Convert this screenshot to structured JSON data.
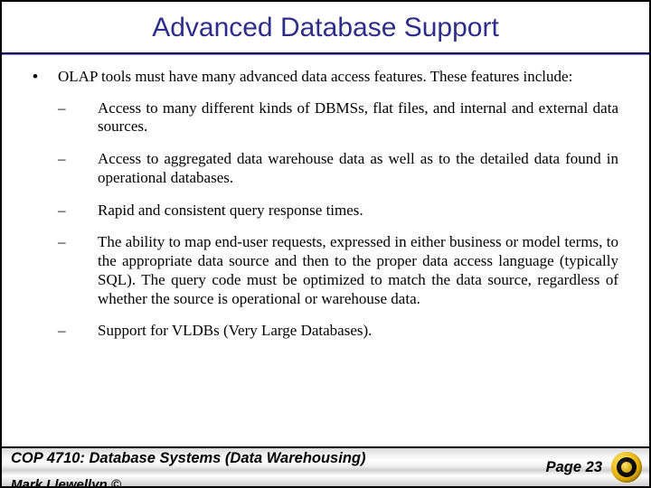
{
  "title": "Advanced Database Support",
  "intro": "OLAP tools must have many advanced data access features.  These features include:",
  "items": [
    "Access to many different kinds of DBMSs, flat files, and internal and external data sources.",
    "Access to aggregated data warehouse data as well as to the detailed data found in operational databases.",
    "Rapid and consistent query response times.",
    "The ability to map end-user requests, expressed in either business or model terms, to the appropriate data source and then to the proper data access language (typically SQL).  The query code must be optimized to match the data source, regardless of whether the source is operational or warehouse data.",
    "Support for VLDBs (Very Large Databases)."
  ],
  "footer": {
    "course": "COP 4710: Database Systems  (Data Warehousing)",
    "author": "Mark Llewellyn ©",
    "page": "Page 23"
  }
}
